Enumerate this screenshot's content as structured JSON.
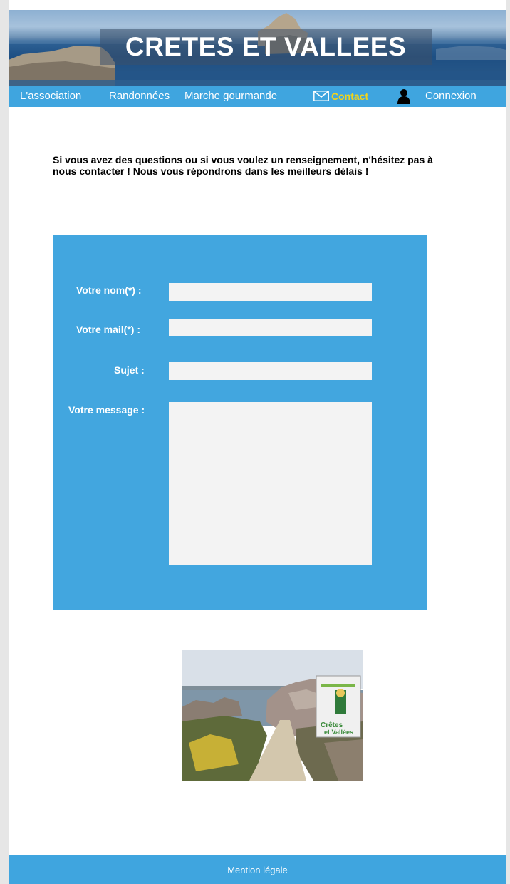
{
  "header": {
    "site_title": "CRETES ET VALLEES"
  },
  "nav": {
    "items": [
      {
        "label": "L'association"
      },
      {
        "label": "Randonnées"
      },
      {
        "label": "Marche gourmande"
      },
      {
        "label": "Contact",
        "icon": "envelope-icon",
        "active": true
      },
      {
        "label": "Connexion",
        "icon": "user-icon"
      }
    ]
  },
  "intro": {
    "text": "Si vous avez des questions ou si vous voulez un renseignement, n'hésitez pas à nous contacter ! Nous vous répondrons dans les meilleurs délais !"
  },
  "form": {
    "name_label": "Votre nom(*) :",
    "name_value": "",
    "mail_label": "Votre mail(*) :",
    "mail_value": "",
    "subject_label": "Sujet :",
    "subject_value": "",
    "message_label": "Votre message :",
    "message_value": ""
  },
  "photo": {
    "sign_line1": "Crêtes",
    "sign_line2": "et Vallées"
  },
  "footer": {
    "legal_link": "Mention légale"
  },
  "colors": {
    "accent_blue": "#3fa5df",
    "active_nav": "#f2d41a",
    "field_bg": "#f3f3f3"
  }
}
